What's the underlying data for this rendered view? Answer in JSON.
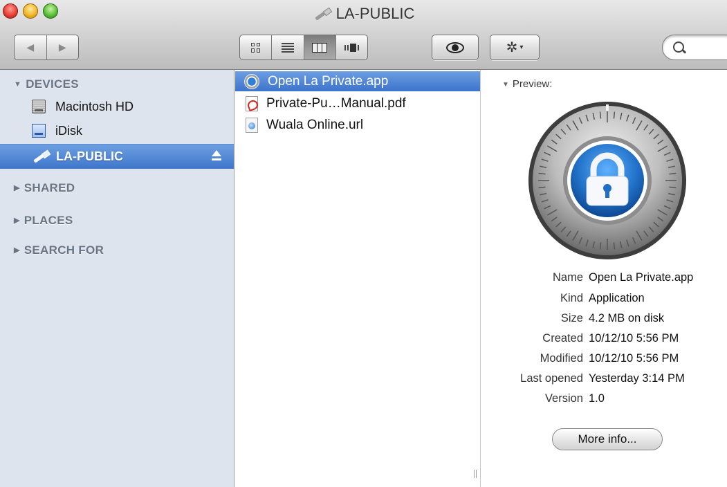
{
  "window": {
    "title": "LA-PUBLIC"
  },
  "toolbar": {
    "back_glyph": "◀",
    "forward_glyph": "▶",
    "action_glyph": "✲",
    "action_caret": "▾"
  },
  "sidebar": {
    "devices_label": "DEVICES",
    "devices": [
      {
        "label": "Macintosh HD",
        "icon": "hard-drive-icon"
      },
      {
        "label": "iDisk",
        "icon": "idisk-icon"
      },
      {
        "label": "LA-PUBLIC",
        "icon": "usb-drive-icon",
        "selected": true
      }
    ],
    "sections": [
      {
        "label": "SHARED"
      },
      {
        "label": "PLACES"
      },
      {
        "label": "SEARCH FOR"
      }
    ]
  },
  "files": [
    {
      "name": "Open La Private.app",
      "icon": "app-icon",
      "selected": true
    },
    {
      "name": "Private-Pu…Manual.pdf",
      "icon": "pdf-icon"
    },
    {
      "name": "Wuala Online.url",
      "icon": "url-icon"
    }
  ],
  "preview": {
    "header": "Preview:",
    "info": [
      {
        "key": "Name",
        "value": "Open La Private.app"
      },
      {
        "key": "Kind",
        "value": "Application"
      },
      {
        "key": "Size",
        "value": "4.2 MB on disk"
      },
      {
        "key": "Created",
        "value": "10/12/10 5:56 PM"
      },
      {
        "key": "Modified",
        "value": "10/12/10 5:56 PM"
      },
      {
        "key": "Last opened",
        "value": "Yesterday 3:14 PM"
      },
      {
        "key": "Version",
        "value": "1.0"
      }
    ],
    "more_info_label": "More info..."
  },
  "colors": {
    "selection": "#3f76cc",
    "sidebar_bg": "#dde4ed",
    "lock_blue": "#1f6fc6"
  }
}
